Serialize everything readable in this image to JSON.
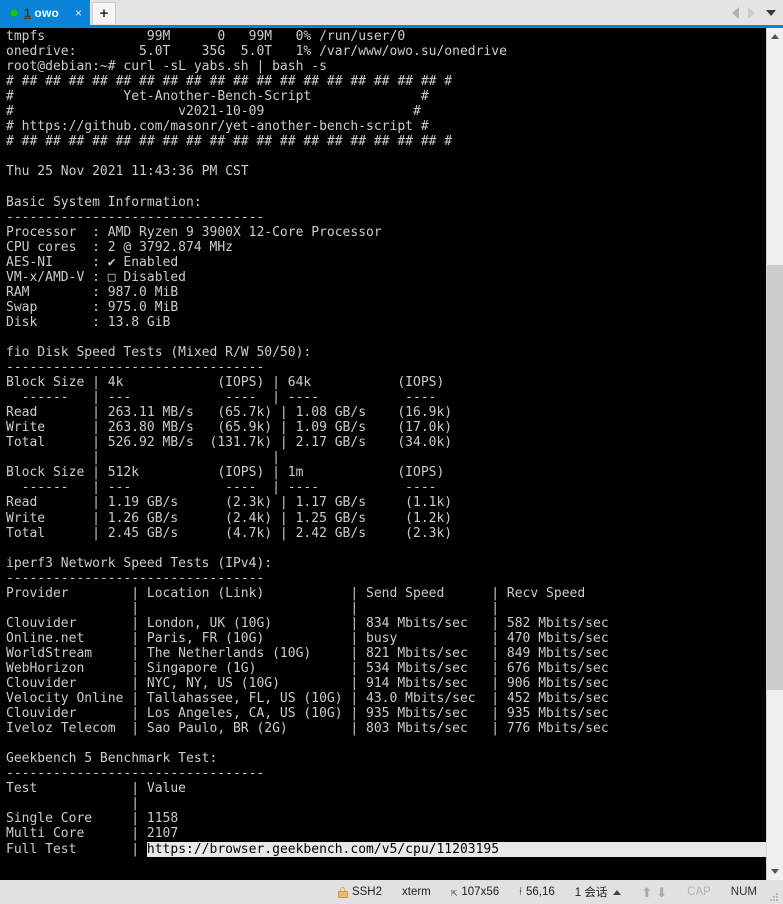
{
  "window": {
    "accent_color": "#0a84d8",
    "terminal_bg": "#000000",
    "terminal_fg": "#cccccc"
  },
  "tabbar": {
    "tabs": [
      {
        "index_label": "1",
        "title": "owo",
        "status_dot": "green-dot-icon",
        "close_label": "×"
      }
    ],
    "new_tab_label": "+",
    "nav_prev": "nav-prev-icon",
    "nav_next": "nav-next-icon",
    "tab_menu": "chevron-down-icon"
  },
  "terminal": {
    "lines": [
      {
        "text": "tmpfs             99M      0   99M   0% /run/user/0"
      },
      {
        "text": "onedrive:        5.0T    35G  5.0T   1% /var/www/owo.su/onedrive"
      },
      {
        "text": "root@debian:~# curl -sL yabs.sh | bash -s"
      },
      {
        "text": "# ## ## ## ## ## ## ## ## ## ## ## ## ## ## ## ## ## ## #"
      },
      {
        "text": "#              Yet-Another-Bench-Script              #"
      },
      {
        "text": "#                     v2021-10-09                   #"
      },
      {
        "text": "# https://github.com/masonr/yet-another-bench-script #"
      },
      {
        "text": "# ## ## ## ## ## ## ## ## ## ## ## ## ## ## ## ## ## ## #"
      },
      {
        "text": ""
      },
      {
        "text": "Thu 25 Nov 2021 11:43:36 PM CST"
      },
      {
        "text": ""
      },
      {
        "text": "Basic System Information:"
      },
      {
        "text": "---------------------------------"
      },
      {
        "text": "Processor  : AMD Ryzen 9 3900X 12-Core Processor"
      },
      {
        "text": "CPU cores  : 2 @ 3792.874 MHz"
      },
      {
        "text": "AES-NI     : ✔ Enabled"
      },
      {
        "text": "VM-x/AMD-V : □ Disabled"
      },
      {
        "text": "RAM        : 987.0 MiB"
      },
      {
        "text": "Swap       : 975.0 MiB"
      },
      {
        "text": "Disk       : 13.8 GiB"
      },
      {
        "text": ""
      },
      {
        "text": "fio Disk Speed Tests (Mixed R/W 50/50):"
      },
      {
        "text": "---------------------------------"
      },
      {
        "text": "Block Size | 4k            (IOPS) | 64k           (IOPS)"
      },
      {
        "text": "  ------   | ---            ----  | ----           ----"
      },
      {
        "text": "Read       | 263.11 MB/s   (65.7k) | 1.08 GB/s    (16.9k)"
      },
      {
        "text": "Write      | 263.80 MB/s   (65.9k) | 1.09 GB/s    (17.0k)"
      },
      {
        "text": "Total      | 526.92 MB/s  (131.7k) | 2.17 GB/s    (34.0k)"
      },
      {
        "text": "           |                      |"
      },
      {
        "text": "Block Size | 512k          (IOPS) | 1m            (IOPS)"
      },
      {
        "text": "  ------   | ---            ----  | ----           ----"
      },
      {
        "text": "Read       | 1.19 GB/s      (2.3k) | 1.17 GB/s     (1.1k)"
      },
      {
        "text": "Write      | 1.26 GB/s      (2.4k) | 1.25 GB/s     (1.2k)"
      },
      {
        "text": "Total      | 2.45 GB/s      (4.7k) | 2.42 GB/s     (2.3k)"
      },
      {
        "text": ""
      },
      {
        "text": "iperf3 Network Speed Tests (IPv4):"
      },
      {
        "text": "---------------------------------"
      },
      {
        "text": "Provider        | Location (Link)           | Send Speed      | Recv Speed"
      },
      {
        "text": "                |                           |                 |"
      },
      {
        "text": "Clouvider       | London, UK (10G)          | 834 Mbits/sec   | 582 Mbits/sec"
      },
      {
        "text": "Online.net      | Paris, FR (10G)           | busy            | 470 Mbits/sec"
      },
      {
        "text": "WorldStream     | The Netherlands (10G)     | 821 Mbits/sec   | 849 Mbits/sec"
      },
      {
        "text": "WebHorizon      | Singapore (1G)            | 534 Mbits/sec   | 676 Mbits/sec"
      },
      {
        "text": "Clouvider       | NYC, NY, US (10G)         | 914 Mbits/sec   | 906 Mbits/sec"
      },
      {
        "text": "Velocity Online | Tallahassee, FL, US (10G) | 43.0 Mbits/sec  | 452 Mbits/sec"
      },
      {
        "text": "Clouvider       | Los Angeles, CA, US (10G) | 935 Mbits/sec   | 935 Mbits/sec"
      },
      {
        "text": "Iveloz Telecom  | Sao Paulo, BR (2G)        | 803 Mbits/sec   | 776 Mbits/sec"
      },
      {
        "text": ""
      },
      {
        "text": "Geekbench 5 Benchmark Test:"
      },
      {
        "text": "---------------------------------"
      },
      {
        "text": "Test            | Value"
      },
      {
        "text": "                |"
      },
      {
        "text": "Single Core     | 1158"
      },
      {
        "text": "Multi Core      | 2107"
      }
    ],
    "last_line": {
      "prefix": "Full Test       | ",
      "highlighted_url": "https://browser.geekbench.com/v5/cpu/11203195"
    }
  },
  "scrollbar": {
    "up_arrow": "scroll-up-icon",
    "down_arrow": "scroll-down-icon"
  },
  "statusbar": {
    "protocol": "SSH2",
    "term_type": "xterm",
    "dimensions": "107x56",
    "cursor_position": "56,16",
    "sessions": "1 会话",
    "caps_label": "CAP",
    "num_label": "NUM",
    "lock_icon": "lock-icon",
    "up_arrow": "⬆",
    "down_arrow": "⬇"
  }
}
